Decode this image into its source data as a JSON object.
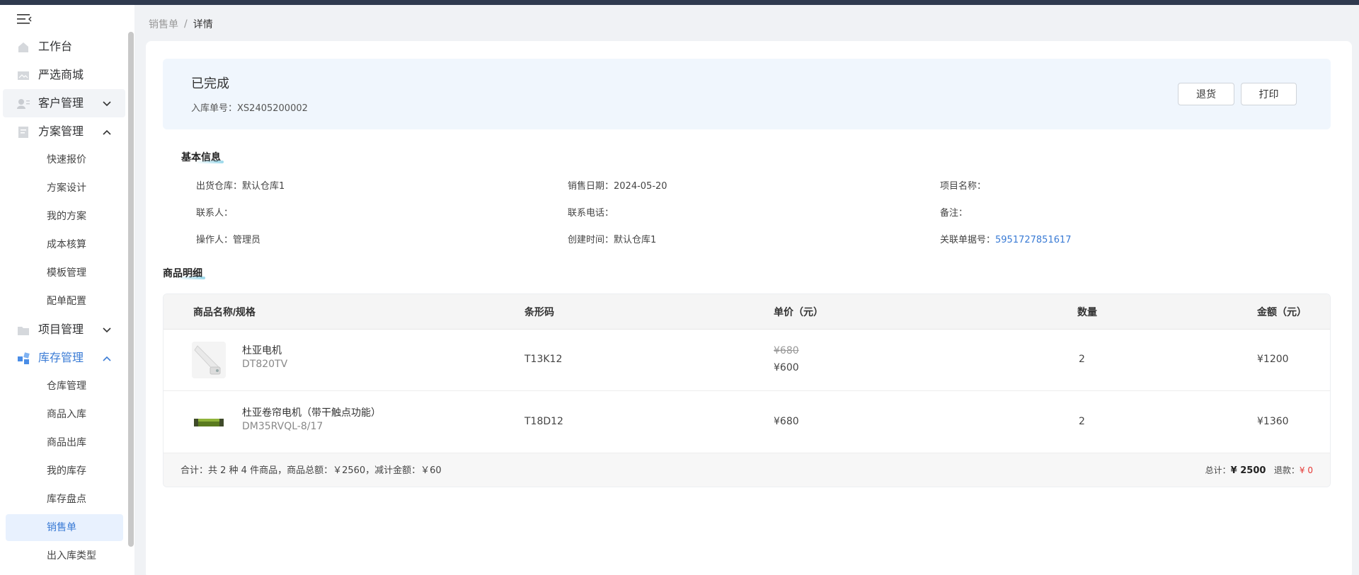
{
  "breadcrumb": {
    "parent": "销售单",
    "separator": "/",
    "current": "详情"
  },
  "sidebar": {
    "items": [
      {
        "label": "工作台",
        "icon": "home-icon"
      },
      {
        "label": "严选商城",
        "icon": "image-icon"
      },
      {
        "label": "客户管理",
        "icon": "customer-icon",
        "chevron": "down"
      },
      {
        "label": "方案管理",
        "icon": "document-icon",
        "chevron": "up"
      },
      {
        "label": "项目管理",
        "icon": "folder-icon",
        "chevron": "down"
      },
      {
        "label": "库存管理",
        "icon": "inventory-icon",
        "chevron": "up"
      }
    ],
    "plan_sub": [
      "快速报价",
      "方案设计",
      "我的方案",
      "成本核算",
      "模板管理",
      "配单配置"
    ],
    "stock_sub": [
      "仓库管理",
      "商品入库",
      "商品出库",
      "我的库存",
      "库存盘点",
      "销售单",
      "出入库类型"
    ]
  },
  "status": {
    "title": "已完成",
    "order_label": "入库单号：",
    "order_no": "XS2405200002"
  },
  "buttons": {
    "return": "退货",
    "print": "打印"
  },
  "basic_info": {
    "title": "基本信息",
    "warehouse": "出货仓库：默认仓库1",
    "sale_date": "销售日期：2024-05-20",
    "project_name": "项目名称：",
    "contact": "联系人：",
    "phone": "联系电话：",
    "remark": "备注：",
    "operator": "操作人：管理员",
    "created": "创建时间：默认仓库1",
    "related_label": "关联单据号：",
    "related_no": "5951727851617"
  },
  "goods": {
    "title": "商品明细",
    "columns": [
      "商品名称/规格",
      "条形码",
      "单价（元）",
      "数量",
      "金额（元）"
    ],
    "rows": [
      {
        "name": "杜亚电机",
        "spec": "DT820TV",
        "barcode": "T13K12",
        "orig_price": "¥680",
        "price": "¥600",
        "qty": "2",
        "amount": "¥1200"
      },
      {
        "name": "杜亚卷帘电机（带干触点功能）",
        "spec": "DM35RVQL-8/17",
        "barcode": "T18D12",
        "orig_price": "",
        "price": "¥680",
        "qty": "2",
        "amount": "¥1360"
      }
    ],
    "footer_left": "合计：共 2 种 4 件商品，商品总额：￥2560，减计金额：￥60",
    "total_label": "总计：",
    "total_value": "¥ 2500",
    "refund_label": "退款：",
    "refund_value": "¥ 0"
  },
  "colors": {
    "accent": "#3a7bd5",
    "status_bg": "#f0f6fd",
    "danger": "#e53935"
  }
}
